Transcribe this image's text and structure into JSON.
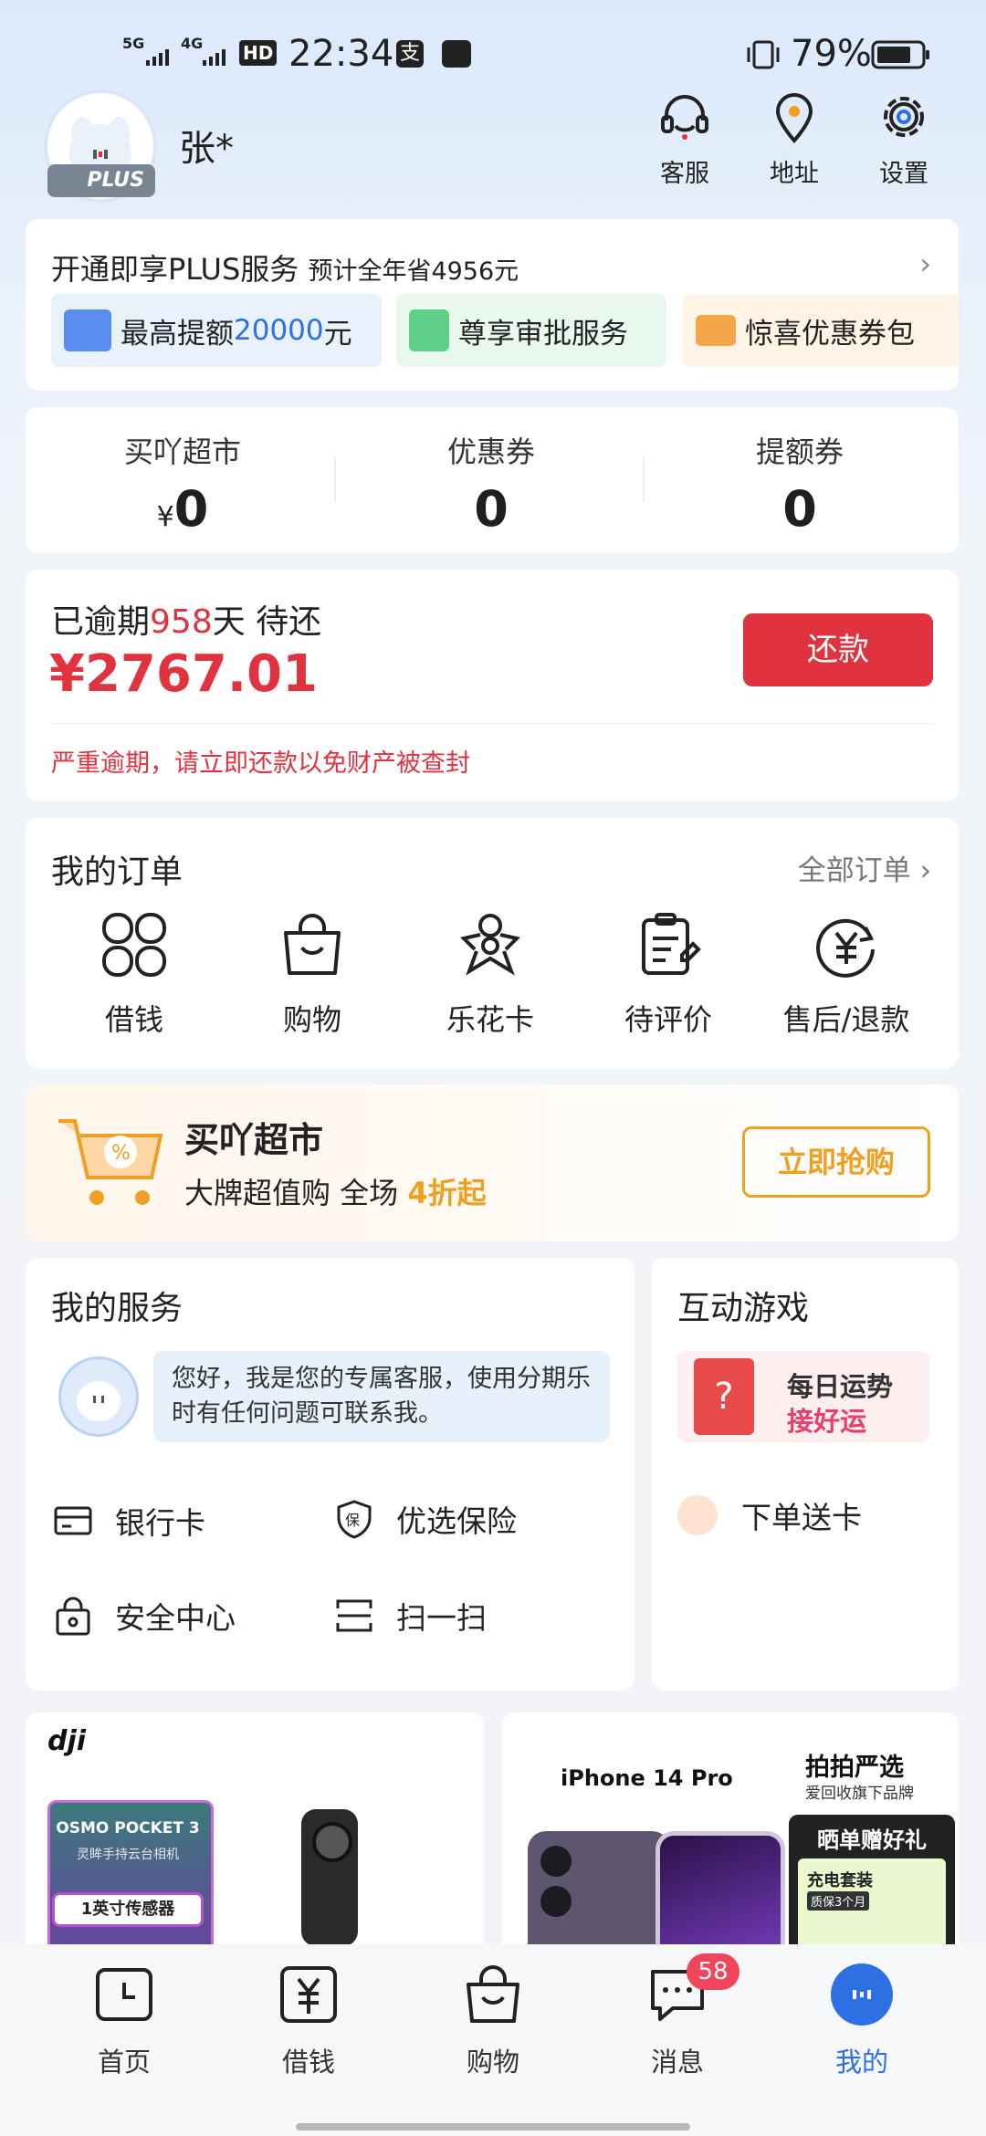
{
  "status_bar": {
    "net1": "5G",
    "net2": "4G",
    "hd": "HD",
    "time": "22:34",
    "battery": "79%"
  },
  "profile": {
    "name": "张*",
    "plus_badge": "PLUS"
  },
  "top_actions": [
    {
      "label": "客服",
      "icon": "headset-icon"
    },
    {
      "label": "地址",
      "icon": "location-pin-icon"
    },
    {
      "label": "设置",
      "icon": "gear-icon"
    }
  ],
  "plus": {
    "title": "开通即享PLUS服务",
    "subtitle": "预计全年省4956元",
    "chips": [
      {
        "prefix": "最高提额",
        "highlight": "20000",
        "suffix": "元",
        "icon": "credit-limit-icon",
        "color": "#e8f1fc"
      },
      {
        "text": "尊享审批服务",
        "icon": "approval-icon",
        "color": "#e8f8ee"
      },
      {
        "text": "惊喜优惠券包",
        "icon": "coupon-icon",
        "color": "#fff3e6"
      }
    ]
  },
  "stats": [
    {
      "label": "买吖超市",
      "currency": "¥",
      "value": "0"
    },
    {
      "label": "优惠券",
      "value": "0"
    },
    {
      "label": "提额券",
      "value": "0"
    }
  ],
  "repay": {
    "prefix": "已逾期",
    "days": "958",
    "suffix": "天 待还",
    "amount": "¥2767.01",
    "button": "还款",
    "warning": "严重逾期，请立即还款以免财产被查封"
  },
  "orders": {
    "title": "我的订单",
    "all": "全部订单",
    "items": [
      {
        "label": "借钱",
        "icon": "grid-petal-icon"
      },
      {
        "label": "购物",
        "icon": "shopping-bag-icon"
      },
      {
        "label": "乐花卡",
        "icon": "flower-card-icon"
      },
      {
        "label": "待评价",
        "icon": "review-clipboard-icon"
      },
      {
        "label": "售后/退款",
        "icon": "refund-yen-icon"
      }
    ]
  },
  "promo": {
    "title": "买吖超市",
    "sub_prefix": "大牌超值购 全场 ",
    "sub_highlight": "4折起",
    "button": "立即抢购"
  },
  "services": {
    "title": "我的服务",
    "bot_message": "您好，我是您的专属客服，使用分期乐时有任何问题可联系我。",
    "items": [
      {
        "label": "银行卡",
        "icon": "bank-card-icon"
      },
      {
        "label": "优选保险",
        "icon": "insurance-shield-icon"
      },
      {
        "label": "安全中心",
        "icon": "lock-icon"
      },
      {
        "label": "扫一扫",
        "icon": "scan-icon"
      }
    ]
  },
  "games": {
    "title": "互动游戏",
    "fortune_title": "每日运势",
    "fortune_sub": "接好运",
    "order_card": "下单送卡"
  },
  "ads": {
    "dji_logo": "dji",
    "osmo_title": "OSMO POCKET 3",
    "osmo_sub": "灵眸手持云台相机",
    "osmo_badge": "1英寸传感器",
    "iphone_title": "iPhone 14 Pro",
    "paipai": "拍拍严选",
    "paipai_sub": "爱回收旗下品牌",
    "gift": "晒单赠好礼",
    "gift_item": "充电套装",
    "gift_warranty": "质保3个月"
  },
  "bottom_nav": [
    {
      "label": "首页",
      "icon": "clock-icon"
    },
    {
      "label": "借钱",
      "icon": "yen-icon"
    },
    {
      "label": "购物",
      "icon": "shopping-bag-icon"
    },
    {
      "label": "消息",
      "icon": "chat-icon",
      "badge": "58"
    },
    {
      "label": "我的",
      "icon": "profile-dot-icon",
      "active": true
    }
  ],
  "colors": {
    "accent_red": "#e0333f",
    "accent_blue": "#2f6fe4",
    "orange": "#f0a020"
  }
}
